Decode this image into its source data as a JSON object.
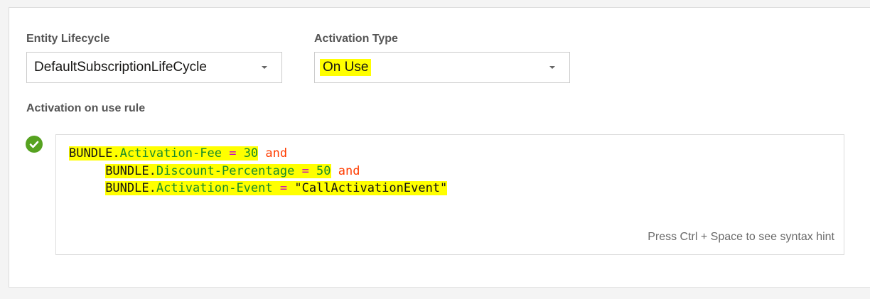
{
  "entity_lifecycle": {
    "label": "Entity Lifecycle",
    "value": "DefaultSubscriptionLifeCycle"
  },
  "activation_type": {
    "label": "Activation Type",
    "value": "On Use"
  },
  "rule": {
    "label": "Activation on use rule",
    "status_icon": "check-circle-icon",
    "status_color": "#56a220",
    "hint": "Press Ctrl + Space to see syntax hint",
    "lines": [
      {
        "indent": "",
        "object": "BUNDLE",
        "dot": ".",
        "field": "Activation-Fee",
        "op": " = ",
        "value": "30",
        "conj": " and"
      },
      {
        "indent": "     ",
        "object": "BUNDLE",
        "dot": ".",
        "field": "Discount-Percentage",
        "op": " = ",
        "value": "50",
        "conj": " and"
      },
      {
        "indent": "     ",
        "object": "BUNDLE",
        "dot": ".",
        "field": "Activation-Event",
        "op": " = ",
        "value": "\"CallActivationEvent\"",
        "conj": ""
      }
    ]
  },
  "colors": {
    "highlight": "#ffff00",
    "keyword_green": "#1a8c2b",
    "operator_magenta": "#c700c7",
    "conjunction_orange": "#ff3c00"
  }
}
